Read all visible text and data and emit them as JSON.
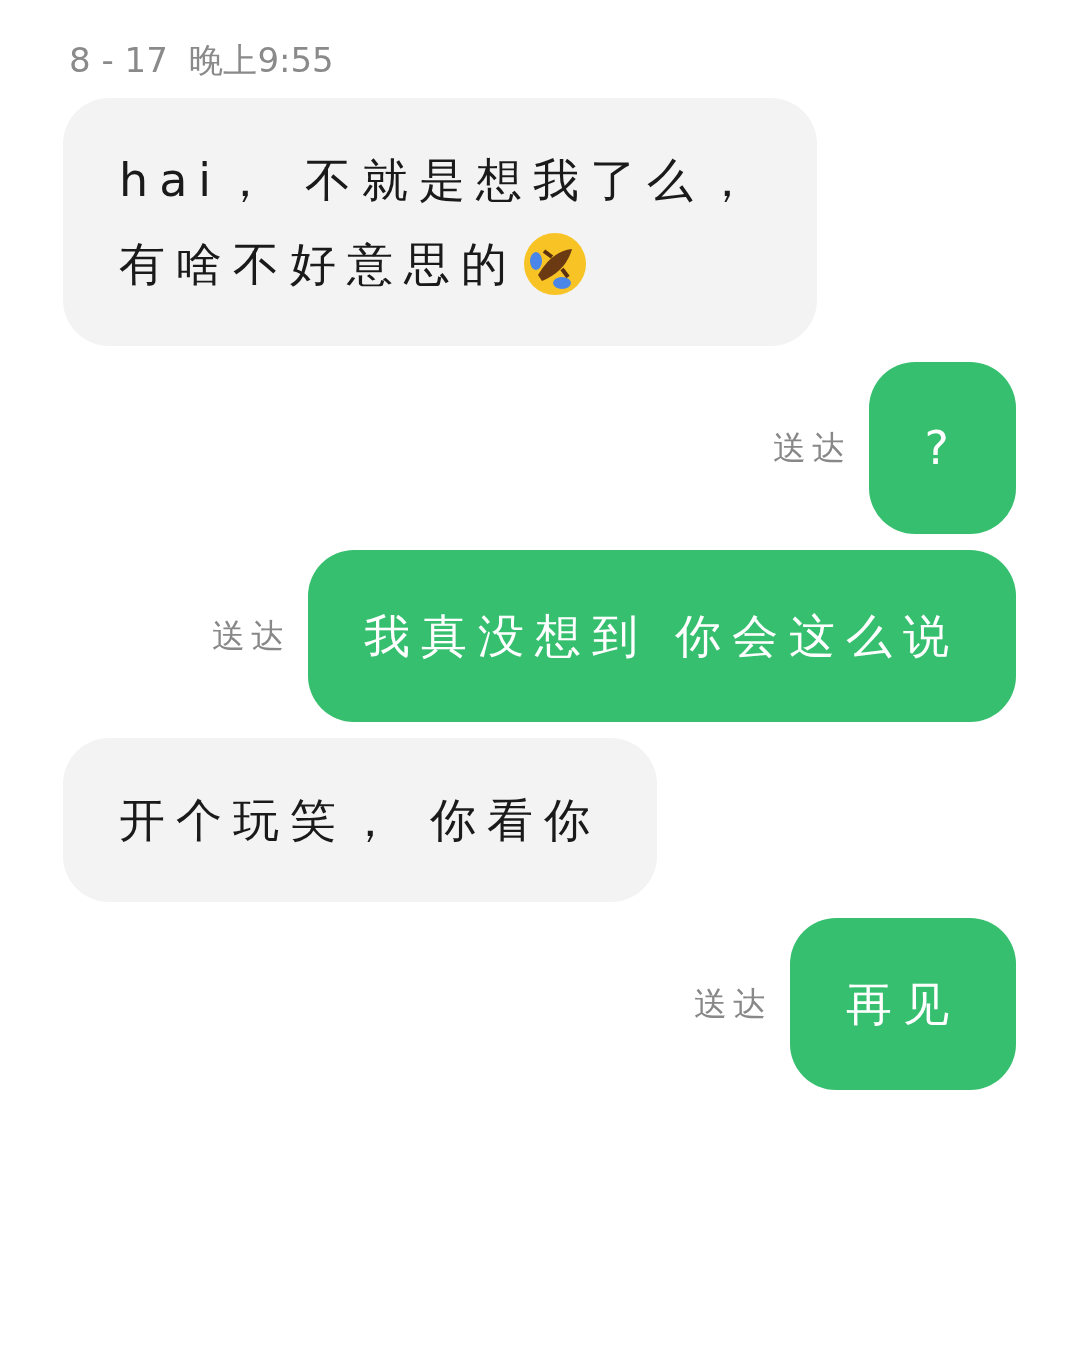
{
  "timestamp": "8 - 17  晚上9:55",
  "messages": [
    {
      "outgoing": false,
      "lines": [
        "hai， 不就是想我了么，",
        "有啥不好意思的"
      ],
      "emoji": true
    },
    {
      "outgoing": true,
      "lines": [
        "?"
      ],
      "status": "送达"
    },
    {
      "outgoing": true,
      "lines": [
        "我真没想到 你会这么说"
      ],
      "status": "送达"
    },
    {
      "outgoing": false,
      "lines": [
        "开个玩笑， 你看你"
      ]
    },
    {
      "outgoing": true,
      "lines": [
        "再见"
      ],
      "status": "送达"
    }
  ]
}
